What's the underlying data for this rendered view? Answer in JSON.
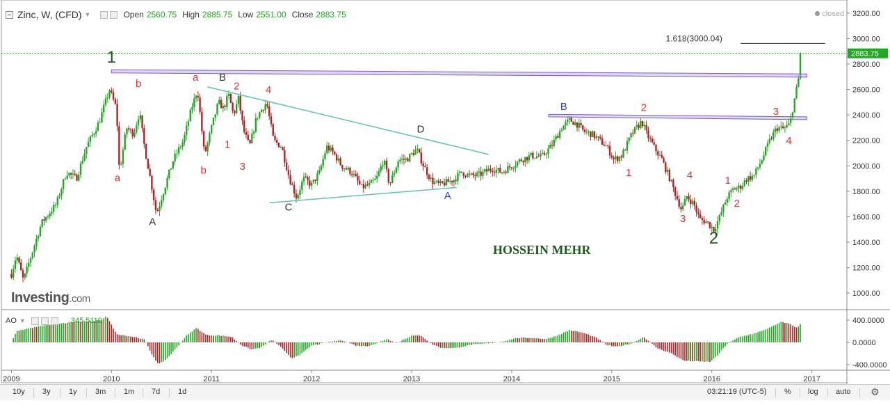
{
  "header": {
    "symbol": "Zinc, W, (CFD)",
    "open_label": "Open",
    "open": "2560.75",
    "high_label": "High",
    "high": "2885.75",
    "low_label": "Low",
    "low": "2551.00",
    "close_label": "Close",
    "close": "2883.75",
    "status": "closed"
  },
  "indicator": {
    "name": "AO",
    "value": "345.5110"
  },
  "watermark": {
    "brand": "Investing",
    "suffix": ".com"
  },
  "author": "HOSSEIN MEHR",
  "fib_label": "1.618(3000.04)",
  "price_tag": "2883.75",
  "time_display": "03:21:19 (UTC-5)",
  "toolbar": {
    "ranges": [
      "10y",
      "3y",
      "1y",
      "3m",
      "1m",
      "7d",
      "1d"
    ],
    "right": [
      "%",
      "log",
      "auto"
    ]
  },
  "colors": {
    "up": "#22a822",
    "down": "#b22222",
    "wave": "#e03030",
    "abc": "#333333",
    "blue_wave": "#3344cc",
    "trendline": "#5fc4b0",
    "resistance": "#b8a4e6"
  },
  "chart_data": {
    "type": "candlestick",
    "timeframe": "weekly",
    "x_ticks": [
      2009,
      2010,
      2011,
      2012,
      2013,
      2014,
      2015,
      2016,
      2017
    ],
    "y_ticks": [
      1000,
      1200,
      1400,
      1600,
      1800,
      2000,
      2200,
      2400,
      2600,
      2800,
      3000,
      3200
    ],
    "y_tick_labels": [
      "1000.00",
      "1200.00",
      "1400.00",
      "1600.00",
      "1800.00",
      "2000.00",
      "2200.00",
      "2400.00",
      "2600.00",
      "2800.00",
      "3000.00",
      "3200.00"
    ],
    "ylim": [
      870,
      3270
    ],
    "xlim": [
      2008.9,
      2017.35
    ],
    "price_path": [
      [
        2009.0,
        1150
      ],
      [
        2009.05,
        1300
      ],
      [
        2009.12,
        1100
      ],
      [
        2009.2,
        1300
      ],
      [
        2009.3,
        1550
      ],
      [
        2009.45,
        1700
      ],
      [
        2009.55,
        1950
      ],
      [
        2009.65,
        1900
      ],
      [
        2009.75,
        2150
      ],
      [
        2009.88,
        2350
      ],
      [
        2009.98,
        2600
      ],
      [
        2010.05,
        2450
      ],
      [
        2010.08,
        1950
      ],
      [
        2010.15,
        2300
      ],
      [
        2010.22,
        2250
      ],
      [
        2010.28,
        2420
      ],
      [
        2010.33,
        2150
      ],
      [
        2010.4,
        1850
      ],
      [
        2010.45,
        1620
      ],
      [
        2010.52,
        1800
      ],
      [
        2010.62,
        2050
      ],
      [
        2010.72,
        2200
      ],
      [
        2010.8,
        2450
      ],
      [
        2010.86,
        2600
      ],
      [
        2010.93,
        2080
      ],
      [
        2011.0,
        2300
      ],
      [
        2011.07,
        2500
      ],
      [
        2011.12,
        2450
      ],
      [
        2011.17,
        2560
      ],
      [
        2011.22,
        2400
      ],
      [
        2011.27,
        2530
      ],
      [
        2011.32,
        2280
      ],
      [
        2011.38,
        2150
      ],
      [
        2011.45,
        2380
      ],
      [
        2011.55,
        2500
      ],
      [
        2011.62,
        2200
      ],
      [
        2011.7,
        2150
      ],
      [
        2011.78,
        1900
      ],
      [
        2011.85,
        1750
      ],
      [
        2011.92,
        1900
      ],
      [
        2012.0,
        1850
      ],
      [
        2012.08,
        1950
      ],
      [
        2012.15,
        2150
      ],
      [
        2012.22,
        2100
      ],
      [
        2012.3,
        2000
      ],
      [
        2012.4,
        1950
      ],
      [
        2012.5,
        1830
      ],
      [
        2012.58,
        1850
      ],
      [
        2012.65,
        1900
      ],
      [
        2012.72,
        2050
      ],
      [
        2012.78,
        1850
      ],
      [
        2012.87,
        2050
      ],
      [
        2012.95,
        2050
      ],
      [
        2013.05,
        2130
      ],
      [
        2013.12,
        2000
      ],
      [
        2013.2,
        1880
      ],
      [
        2013.28,
        1850
      ],
      [
        2013.35,
        1870
      ],
      [
        2013.42,
        1890
      ],
      [
        2013.5,
        1950
      ],
      [
        2013.58,
        1920
      ],
      [
        2013.68,
        1930
      ],
      [
        2013.8,
        1980
      ],
      [
        2013.9,
        1950
      ],
      [
        2014.0,
        2000
      ],
      [
        2014.1,
        2050
      ],
      [
        2014.2,
        2080
      ],
      [
        2014.3,
        2070
      ],
      [
        2014.4,
        2160
      ],
      [
        2014.5,
        2300
      ],
      [
        2014.58,
        2360
      ],
      [
        2014.65,
        2330
      ],
      [
        2014.72,
        2270
      ],
      [
        2014.8,
        2250
      ],
      [
        2014.88,
        2200
      ],
      [
        2014.95,
        2150
      ],
      [
        2015.02,
        2050
      ],
      [
        2015.1,
        2080
      ],
      [
        2015.2,
        2250
      ],
      [
        2015.3,
        2350
      ],
      [
        2015.35,
        2250
      ],
      [
        2015.42,
        2150
      ],
      [
        2015.5,
        2050
      ],
      [
        2015.58,
        1900
      ],
      [
        2015.65,
        1750
      ],
      [
        2015.7,
        1650
      ],
      [
        2015.75,
        1760
      ],
      [
        2015.82,
        1700
      ],
      [
        2015.88,
        1580
      ],
      [
        2015.95,
        1560
      ],
      [
        2016.02,
        1500
      ],
      [
        2016.08,
        1600
      ],
      [
        2016.15,
        1750
      ],
      [
        2016.22,
        1820
      ],
      [
        2016.28,
        1830
      ],
      [
        2016.35,
        1900
      ],
      [
        2016.42,
        1920
      ],
      [
        2016.5,
        2050
      ],
      [
        2016.58,
        2200
      ],
      [
        2016.65,
        2300
      ],
      [
        2016.72,
        2290
      ],
      [
        2016.78,
        2330
      ],
      [
        2016.82,
        2500
      ],
      [
        2016.86,
        2650
      ],
      [
        2016.9,
        2883.75
      ]
    ],
    "wave_labels": [
      {
        "text": "1",
        "x": 2010.0,
        "y": 2810,
        "color": "#1e5c1e",
        "size": 24
      },
      {
        "text": "a",
        "x": 2010.06,
        "y": 1880,
        "color": "#e03030",
        "size": 15
      },
      {
        "text": "b",
        "x": 2010.27,
        "y": 2620,
        "color": "#e03030",
        "size": 15
      },
      {
        "text": "A",
        "x": 2010.41,
        "y": 1535,
        "color": "#333333",
        "size": 15
      },
      {
        "text": "a",
        "x": 2010.84,
        "y": 2670,
        "color": "#e03030",
        "size": 15
      },
      {
        "text": "b",
        "x": 2010.92,
        "y": 1940,
        "color": "#e03030",
        "size": 15
      },
      {
        "text": "B",
        "x": 2011.11,
        "y": 2670,
        "color": "#333333",
        "size": 15
      },
      {
        "text": "1",
        "x": 2011.16,
        "y": 2140,
        "color": "#e03030",
        "size": 15
      },
      {
        "text": "2",
        "x": 2011.25,
        "y": 2600,
        "color": "#e03030",
        "size": 15
      },
      {
        "text": "3",
        "x": 2011.31,
        "y": 1970,
        "color": "#e03030",
        "size": 15
      },
      {
        "text": "4",
        "x": 2011.57,
        "y": 2570,
        "color": "#e03030",
        "size": 15
      },
      {
        "text": "C",
        "x": 2011.77,
        "y": 1650,
        "color": "#333333",
        "size": 15
      },
      {
        "text": "D",
        "x": 2013.09,
        "y": 2260,
        "color": "#333333",
        "size": 15
      },
      {
        "text": "A",
        "x": 2013.36,
        "y": 1740,
        "color": "#3344cc",
        "size": 15
      },
      {
        "text": "B",
        "x": 2014.52,
        "y": 2440,
        "color": "#3344cc",
        "size": 15
      },
      {
        "text": "2",
        "x": 2015.32,
        "y": 2430,
        "color": "#e03030",
        "size": 15
      },
      {
        "text": "1",
        "x": 2015.17,
        "y": 1920,
        "color": "#e03030",
        "size": 15
      },
      {
        "text": "3",
        "x": 2015.71,
        "y": 1560,
        "color": "#e03030",
        "size": 15
      },
      {
        "text": "4",
        "x": 2015.78,
        "y": 1900,
        "color": "#e03030",
        "size": 15
      },
      {
        "text": "2",
        "x": 2016.02,
        "y": 1390,
        "color": "#1e5c1e",
        "size": 24
      },
      {
        "text": "1",
        "x": 2016.16,
        "y": 1860,
        "color": "#e03030",
        "size": 15
      },
      {
        "text": "2",
        "x": 2016.25,
        "y": 1680,
        "color": "#e03030",
        "size": 15
      },
      {
        "text": "3",
        "x": 2016.64,
        "y": 2400,
        "color": "#e03030",
        "size": 15
      },
      {
        "text": "4",
        "x": 2016.77,
        "y": 2170,
        "color": "#e03030",
        "size": 15
      }
    ],
    "trendlines": [
      {
        "x1": 2010.96,
        "y1": 2620,
        "x2": 2013.77,
        "y2": 2090,
        "color": "#5fc4b0"
      },
      {
        "x1": 2011.58,
        "y1": 1710,
        "x2": 2013.45,
        "y2": 1830,
        "color": "#5fc4b0"
      }
    ],
    "resistance_bands": [
      {
        "x1": 2010.0,
        "y_top1": 2755,
        "y_bot1": 2730,
        "x2": 2016.95,
        "y_top2": 2722,
        "y_bot2": 2697
      },
      {
        "x1": 2014.37,
        "y_top1": 2405,
        "y_bot1": 2385,
        "x2": 2016.95,
        "y_top2": 2385,
        "y_bot2": 2363
      }
    ],
    "fib_level": {
      "value": 3000.04,
      "x1": 2015.54,
      "x2": 2017.3
    },
    "last_price": 2883.75,
    "ao": {
      "name": "AO",
      "y_ticks": [
        400.0,
        0.0,
        -400.0
      ],
      "y_tick_labels": [
        "400.0000",
        "0.0000",
        "-400.0000"
      ],
      "ylim": [
        -500,
        500
      ],
      "path": [
        [
          2008.95,
          0
        ],
        [
          2009.0,
          0
        ],
        [
          2009.05,
          200
        ],
        [
          2009.3,
          300
        ],
        [
          2009.6,
          360
        ],
        [
          2009.9,
          400
        ],
        [
          2009.95,
          480
        ],
        [
          2010.05,
          150
        ],
        [
          2010.25,
          90
        ],
        [
          2010.33,
          50
        ],
        [
          2010.4,
          -200
        ],
        [
          2010.47,
          -400
        ],
        [
          2010.55,
          -300
        ],
        [
          2010.65,
          -100
        ],
        [
          2010.75,
          120
        ],
        [
          2010.85,
          260
        ],
        [
          2010.95,
          130
        ],
        [
          2011.1,
          120
        ],
        [
          2011.2,
          100
        ],
        [
          2011.3,
          -50
        ],
        [
          2011.4,
          -130
        ],
        [
          2011.5,
          -90
        ],
        [
          2011.6,
          50
        ],
        [
          2011.68,
          -60
        ],
        [
          2011.8,
          -290
        ],
        [
          2011.9,
          -200
        ],
        [
          2012.0,
          -60
        ],
        [
          2012.15,
          0
        ],
        [
          2012.3,
          40
        ],
        [
          2012.45,
          -60
        ],
        [
          2012.55,
          -70
        ],
        [
          2012.65,
          -20
        ],
        [
          2012.75,
          60
        ],
        [
          2012.85,
          -10
        ],
        [
          2013.0,
          120
        ],
        [
          2013.1,
          120
        ],
        [
          2013.2,
          -30
        ],
        [
          2013.3,
          -100
        ],
        [
          2013.45,
          -100
        ],
        [
          2013.6,
          -40
        ],
        [
          2013.75,
          -20
        ],
        [
          2013.9,
          10
        ],
        [
          2014.05,
          80
        ],
        [
          2014.2,
          80
        ],
        [
          2014.35,
          60
        ],
        [
          2014.45,
          120
        ],
        [
          2014.58,
          220
        ],
        [
          2014.72,
          170
        ],
        [
          2014.85,
          80
        ],
        [
          2014.95,
          -50
        ],
        [
          2015.05,
          -80
        ],
        [
          2015.2,
          -20
        ],
        [
          2015.32,
          100
        ],
        [
          2015.45,
          -100
        ],
        [
          2015.6,
          -200
        ],
        [
          2015.72,
          -330
        ],
        [
          2015.85,
          -340
        ],
        [
          2015.98,
          -350
        ],
        [
          2016.05,
          -250
        ],
        [
          2016.15,
          -30
        ],
        [
          2016.28,
          100
        ],
        [
          2016.45,
          170
        ],
        [
          2016.6,
          280
        ],
        [
          2016.7,
          370
        ],
        [
          2016.78,
          330
        ],
        [
          2016.85,
          260
        ],
        [
          2016.9,
          345.511
        ]
      ]
    }
  }
}
